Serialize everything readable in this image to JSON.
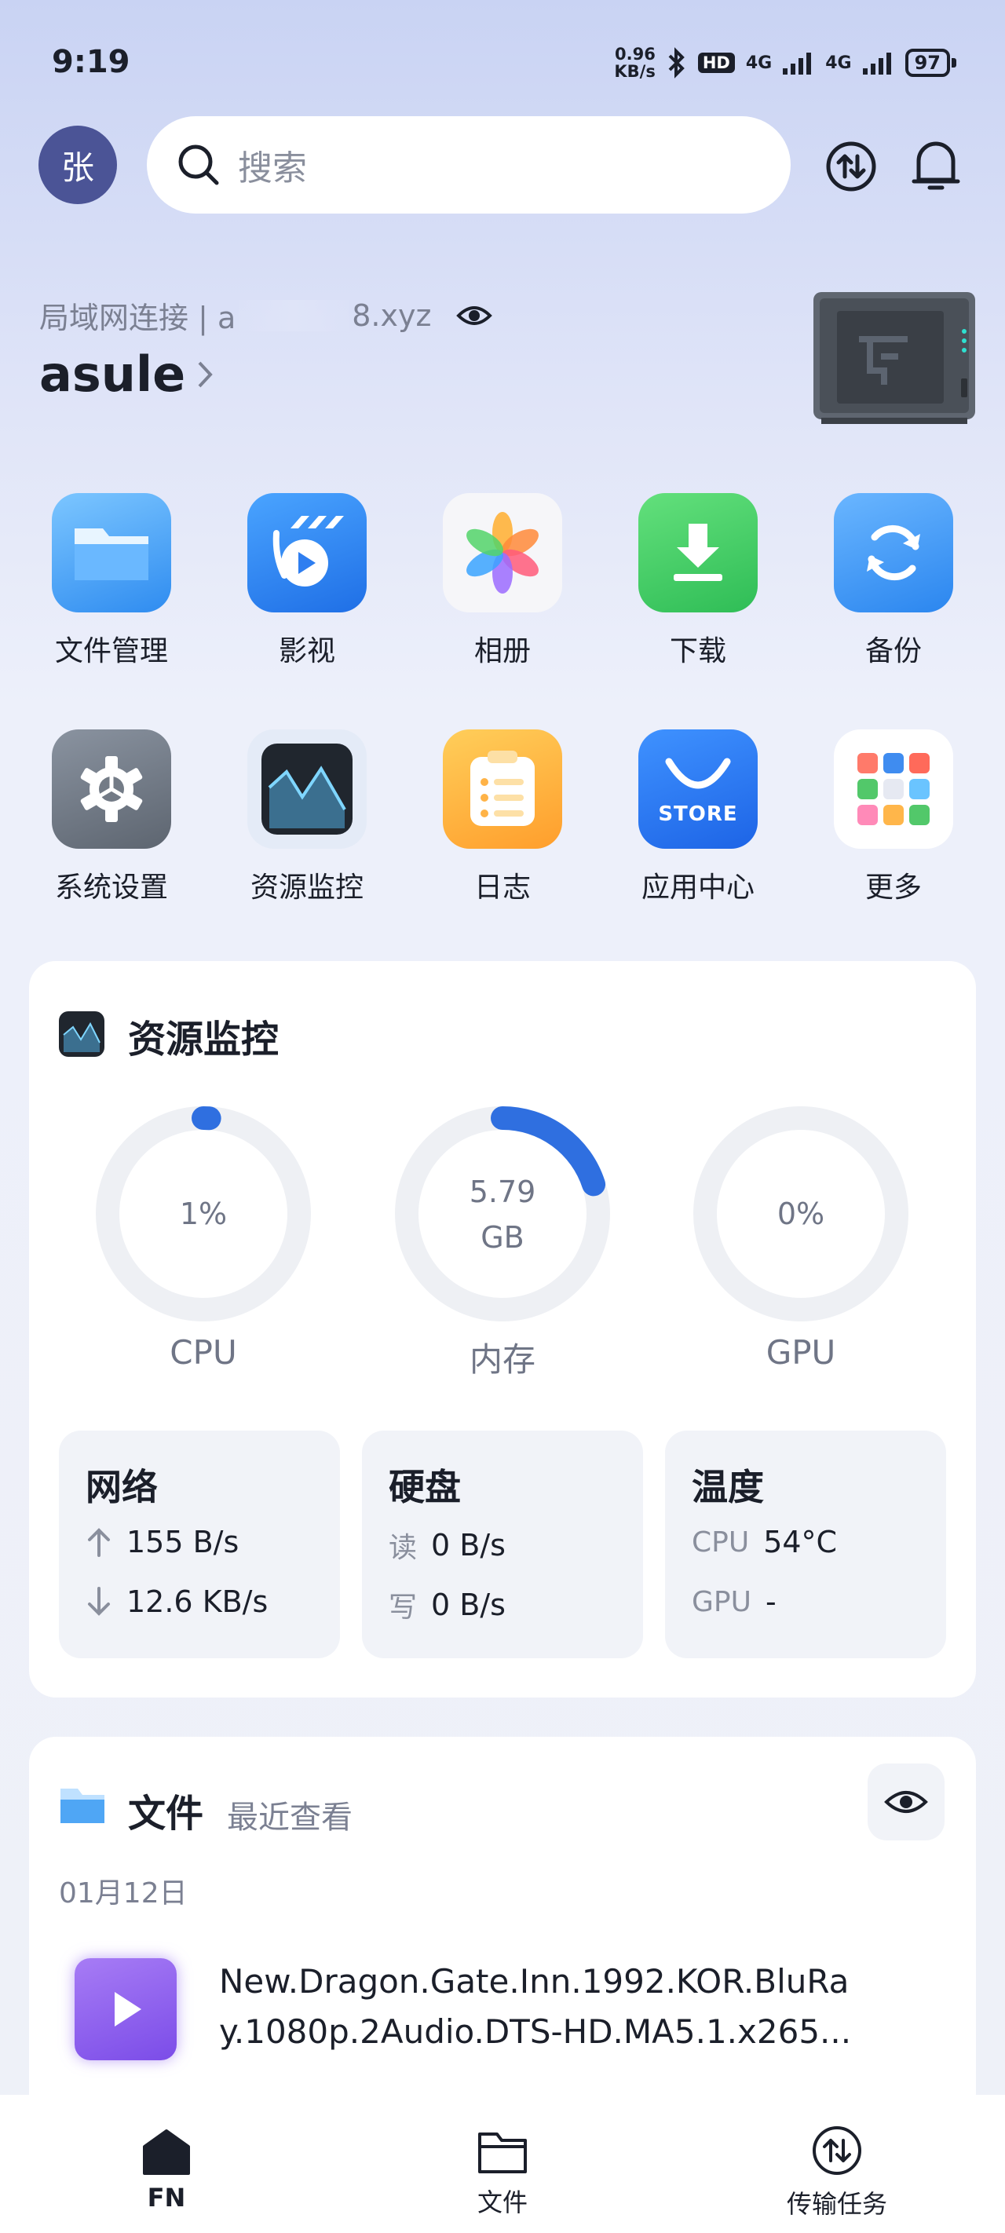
{
  "status_bar": {
    "time": "9:19",
    "net_speed_value": "0.96",
    "net_speed_unit": "KB/s",
    "hd_badge": "HD",
    "signal1": "4G",
    "signal2": "4G",
    "battery": "97"
  },
  "header": {
    "avatar_text": "张",
    "search_placeholder": "搜索"
  },
  "device": {
    "connection_label": "局域网连接 | a",
    "address_suffix": "8.xyz",
    "name": "asule"
  },
  "apps_row1": [
    {
      "label": "文件管理",
      "icon": "folder-icon"
    },
    {
      "label": "影视",
      "icon": "video-icon"
    },
    {
      "label": "相册",
      "icon": "photos-icon"
    },
    {
      "label": "下载",
      "icon": "download-icon"
    },
    {
      "label": "备份",
      "icon": "backup-icon"
    }
  ],
  "apps_row2": [
    {
      "label": "系统设置",
      "icon": "gear-icon"
    },
    {
      "label": "资源监控",
      "icon": "monitor-icon"
    },
    {
      "label": "日志",
      "icon": "log-icon"
    },
    {
      "label": "应用中心",
      "icon": "store-icon",
      "badge": "STORE"
    },
    {
      "label": "更多",
      "icon": "more-icon"
    }
  ],
  "monitor": {
    "title": "资源监控",
    "cpu": {
      "label": "CPU",
      "value": "1%",
      "fraction": 0.01
    },
    "memory": {
      "label": "内存",
      "value": "5.79",
      "unit": "GB",
      "fraction": 0.2
    },
    "gpu": {
      "label": "GPU",
      "value": "0%",
      "fraction": 0.0
    },
    "network": {
      "title": "网络",
      "up": "155 B/s",
      "down": "12.6 KB/s"
    },
    "disk": {
      "title": "硬盘",
      "read_key": "读",
      "read": "0 B/s",
      "write_key": "写",
      "write": "0 B/s"
    },
    "temperature": {
      "title": "温度",
      "cpu_key": "CPU",
      "cpu": "54°C",
      "gpu_key": "GPU",
      "gpu": "-"
    }
  },
  "files": {
    "title": "文件",
    "subtitle": "最近查看",
    "date": "01月12日",
    "item_line1": "New.Dragon.Gate.Inn.1992.KOR.BluRa",
    "item_line2": "y.1080p.2Audio.DTS-HD.MA5.1.x265..."
  },
  "tabbar": {
    "tab1": "FN",
    "tab2": "文件",
    "tab3": "传输任务"
  },
  "colors": {
    "accent": "#2f6fe0",
    "avatar": "#4b5496"
  }
}
